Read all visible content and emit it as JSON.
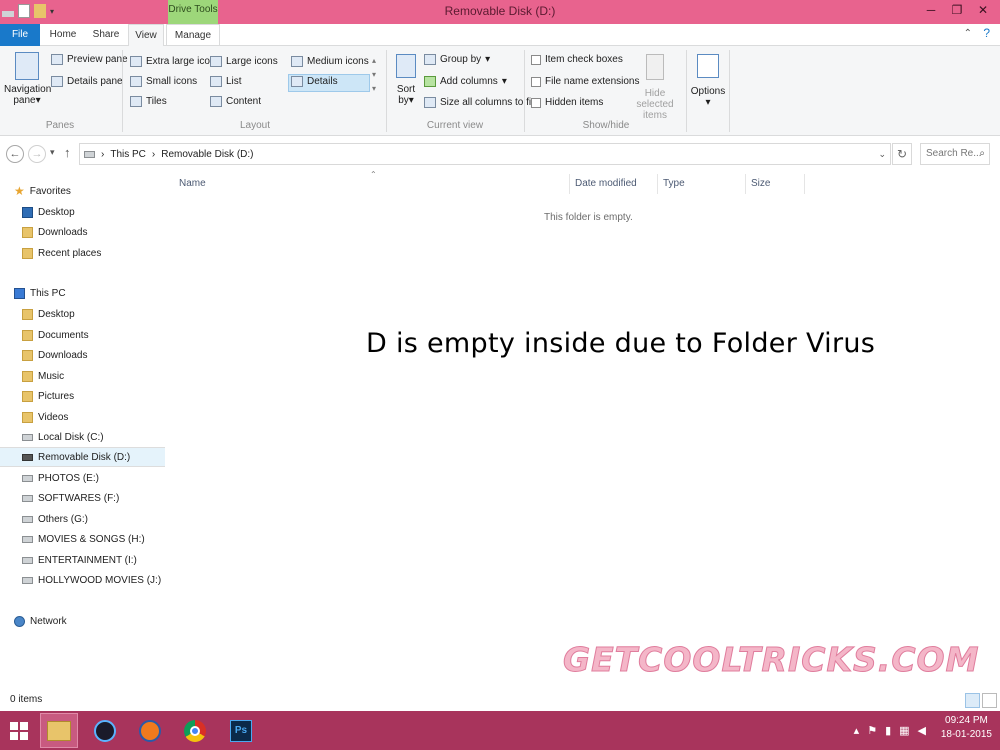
{
  "window": {
    "title": "Removable Disk (D:)",
    "context_tab": "Drive Tools",
    "minimize": "─",
    "restore": "❐",
    "close": "✕"
  },
  "tabs": [
    {
      "label": "File"
    },
    {
      "label": "Home"
    },
    {
      "label": "Share"
    },
    {
      "label": "View"
    },
    {
      "label": "Manage"
    }
  ],
  "ribbon": {
    "panes": {
      "navigation_pane": "Navigation",
      "navigation_pane2": "pane",
      "preview_pane": "Preview pane",
      "details_pane": "Details pane",
      "label": "Panes"
    },
    "layout": {
      "items": [
        "Extra large icons",
        "Large icons",
        "Medium icons",
        "Small icons",
        "List",
        "Details",
        "Tiles",
        "Content"
      ],
      "label": "Layout"
    },
    "current_view": {
      "sort_by": "Sort",
      "sort_by2": "by",
      "group_by": "Group by",
      "add_columns": "Add columns",
      "size_all": "Size all columns to fit",
      "label": "Current view"
    },
    "show_hide": {
      "item_check_boxes": "Item check boxes",
      "file_name_extensions": "File name extensions",
      "hidden_items": "Hidden items",
      "hide_selected": "Hide selected",
      "hide_selected2": "items",
      "label": "Show/hide"
    },
    "options": "Options"
  },
  "address": {
    "this_pc": "This PC",
    "current": "Removable Disk (D:)",
    "search_placeholder": "Search Re..."
  },
  "navpane": {
    "favorites": "Favorites",
    "fav_items": [
      "Desktop",
      "Downloads",
      "Recent places"
    ],
    "this_pc": "This PC",
    "pc_items": [
      "Desktop",
      "Documents",
      "Downloads",
      "Music",
      "Pictures",
      "Videos",
      "Local Disk (C:)",
      "Removable Disk (D:)",
      "PHOTOS (E:)",
      "SOFTWARES (F:)",
      "Others (G:)",
      "MOVIES & SONGS (H:)",
      "ENTERTAINMENT (I:)",
      "HOLLYWOOD MOVIES (J:)"
    ],
    "network": "Network"
  },
  "columns": {
    "name": "Name",
    "date": "Date modified",
    "type": "Type",
    "size": "Size"
  },
  "empty_message": "This folder is empty.",
  "annotation": "D is empty inside due to Folder Virus",
  "watermark": "GETCOOLTRICKS.COM",
  "status": "0 items",
  "taskbar": {
    "time": "09:24 PM",
    "date": "18-01-2015",
    "ps_label": "Ps"
  }
}
